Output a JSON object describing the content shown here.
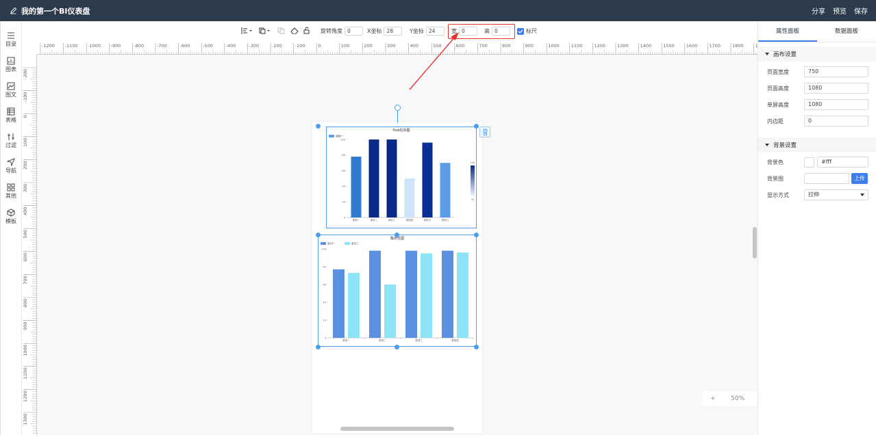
{
  "header": {
    "title": "我的第一个BI仪表盘",
    "share_label": "分享",
    "preview_label": "预览",
    "save_label": "保存",
    "bg_color": "#2d3a4b"
  },
  "sidebar": {
    "items": [
      {
        "label": "目录",
        "icon": "list-icon"
      },
      {
        "label": "图表",
        "icon": "chart-icon"
      },
      {
        "label": "图文",
        "icon": "image-text-icon"
      },
      {
        "label": "表格",
        "icon": "table-icon"
      },
      {
        "label": "过滤",
        "icon": "filter-icon"
      },
      {
        "label": "导航",
        "icon": "navigation-icon"
      },
      {
        "label": "其他",
        "icon": "grid-icon"
      },
      {
        "label": "模板",
        "icon": "cube-icon"
      }
    ]
  },
  "toolbar": {
    "rotation_label": "旋转角度",
    "rotation_value": "0",
    "x_label": "X坐标",
    "x_value": "28",
    "y_label": "Y坐标",
    "y_value": "24",
    "width_label": "宽",
    "width_value": "0",
    "height_label": "高",
    "height_value": "0",
    "ruler_label": "标尺",
    "ruler_checked": true
  },
  "ruler": {
    "top_labels": [
      "-1200",
      "-1100",
      "-1000",
      "-900",
      "-800",
      "-700",
      "-600",
      "-500",
      "-400",
      "-300",
      "-200",
      "-100",
      "0",
      "100",
      "200",
      "300",
      "400",
      "500",
      "600",
      "700",
      "800",
      "900",
      "1000",
      "1100",
      "1200",
      "1300",
      "1400",
      "1500",
      "1600",
      "1700",
      "1800",
      "1900"
    ],
    "left_labels": [
      "-200",
      "-100",
      "0",
      "100",
      "200",
      "300",
      "400",
      "500",
      "600",
      "700",
      "800",
      "900",
      "1000",
      "1100",
      "1200",
      "1300",
      "1400"
    ]
  },
  "right_panel": {
    "tabs": [
      "属性面板",
      "数据面板"
    ],
    "layout_section": {
      "title": "画布设置",
      "fields": [
        {
          "label": "页面宽度",
          "value": "750"
        },
        {
          "label": "页面高度",
          "value": "1080"
        },
        {
          "label": "单屏高度",
          "value": "1080"
        },
        {
          "label": "内边距",
          "value": "0"
        }
      ]
    },
    "background_section": {
      "title": "背景设置",
      "bg_color_label": "背景色",
      "bg_color_value": "#fff",
      "bg_image_label": "背景图",
      "upload_label": "上传",
      "display_label": "显示方式",
      "display_value": "拉伸"
    }
  },
  "zoom": {
    "plus": "+",
    "value": "50%",
    "minus": "-"
  },
  "charts": [
    {
      "chart_data": {
        "type": "bar",
        "title": "flow柱状图",
        "legend": [
          "视频一"
        ],
        "categories": [
          "类别一",
          "类别二",
          "类别三",
          "类别四",
          "类别五",
          "类别六"
        ],
        "values": [
          78,
          100,
          100,
          50,
          96,
          70
        ],
        "colors": [
          "#2e7bcf",
          "#0a2a8a",
          "#0a2a8a",
          "#cfe4fb",
          "#0a2f94",
          "#5c9bea"
        ],
        "ylim": [
          0,
          100
        ],
        "yticks": [
          0,
          20,
          40,
          60,
          80,
          100
        ],
        "visualmap": {
          "max": "100",
          "min": "10"
        }
      }
    },
    {
      "chart_data": {
        "type": "bar",
        "title": "簇状柱图",
        "categories": [
          "类别一",
          "类别二",
          "类别三",
          "类别四"
        ],
        "series": [
          {
            "name": "系列一",
            "values": [
              77,
              98,
              98,
              98
            ],
            "color": "#5b8fe0"
          },
          {
            "name": "系列二",
            "values": [
              73,
              60,
              95,
              96
            ],
            "color": "#8ee4f7"
          }
        ],
        "ylim": [
          0,
          100
        ],
        "yticks": [
          0,
          20,
          40,
          60,
          80,
          100
        ]
      }
    }
  ]
}
